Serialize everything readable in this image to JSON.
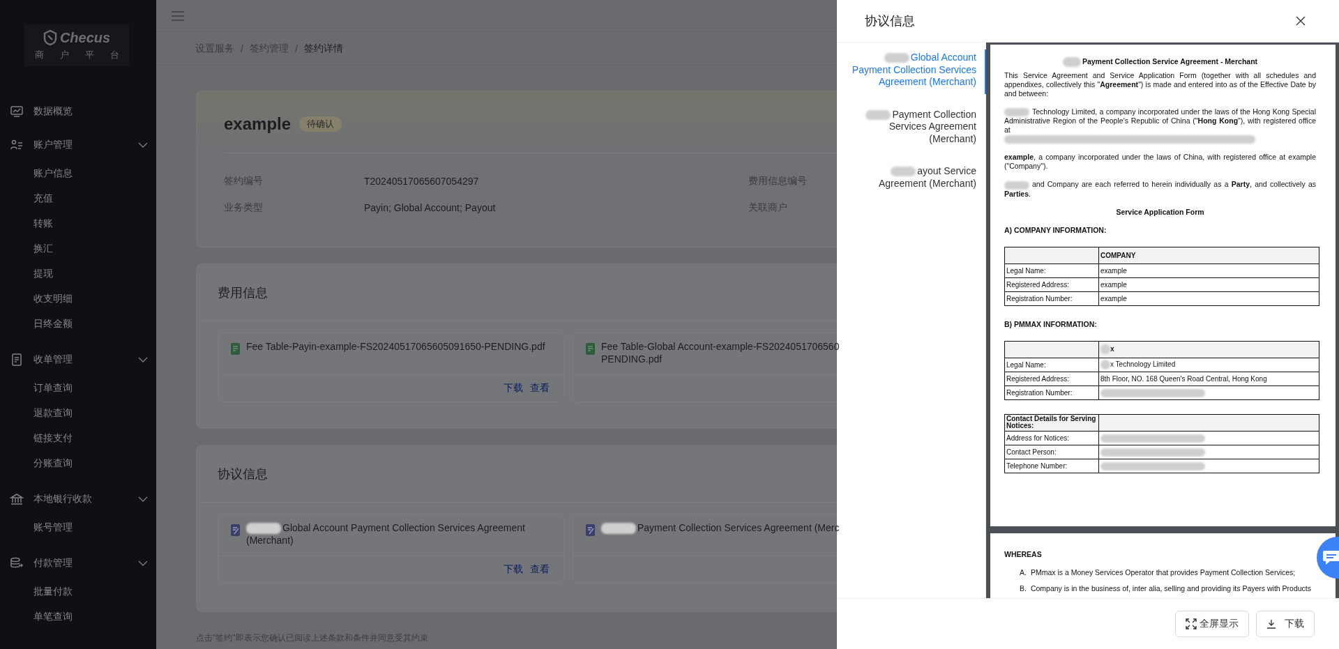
{
  "sidebar": {
    "logo_text": "Checus",
    "logo_subtitle": "商户平台",
    "items": [
      {
        "kind": "link",
        "label": "数据概览"
      },
      {
        "kind": "group",
        "label": "账户管理",
        "expanded": true,
        "children": [
          {
            "label": "账户信息"
          },
          {
            "label": "充值"
          },
          {
            "label": "转账"
          },
          {
            "label": "换汇"
          },
          {
            "label": "提现"
          },
          {
            "label": "收支明细"
          },
          {
            "label": "日终金额"
          }
        ]
      },
      {
        "kind": "group",
        "label": "收单管理",
        "expanded": true,
        "children": [
          {
            "label": "订单查询"
          },
          {
            "label": "退款查询"
          },
          {
            "label": "链接支付"
          },
          {
            "label": "分账查询"
          }
        ]
      },
      {
        "kind": "group",
        "label": "本地银行收款",
        "expanded": true,
        "children": [
          {
            "label": "账号管理"
          }
        ]
      },
      {
        "kind": "group",
        "label": "付款管理",
        "expanded": true,
        "children": [
          {
            "label": "批量付款"
          },
          {
            "label": "单笔查询"
          }
        ]
      }
    ]
  },
  "breadcrumb": {
    "separator": "/",
    "items": [
      {
        "label": "设置服务",
        "current": false
      },
      {
        "label": "签约管理",
        "current": false
      },
      {
        "label": "签约详情",
        "current": true
      }
    ]
  },
  "contract": {
    "name": "example",
    "status": "待确认",
    "fields": [
      {
        "label": "签约编号",
        "value": "T20240517065607054297",
        "side_label": "费用信息编号"
      },
      {
        "label": "业务类型",
        "value": "Payin; Global Account; Payout",
        "side_label": "关联商户"
      }
    ]
  },
  "sections": [
    {
      "title": "费用信息",
      "files": [
        {
          "kind": "fee",
          "redacted": false,
          "lines": [
            "Fee Table-Payin-example-FS20240517065605091650-PENDING.pdf"
          ],
          "actions": [
            "下载",
            "查看"
          ]
        },
        {
          "kind": "fee",
          "redacted": false,
          "lines": [
            "Fee Table-Global Account-example-FS2024051706560",
            "PENDING.pdf"
          ]
        }
      ]
    },
    {
      "title": "协议信息",
      "files": [
        {
          "kind": "agreement",
          "redacted": true,
          "lines": [
            "Global Account Payment Collection Services Agreement",
            "(Merchant)"
          ],
          "actions": [
            "下载",
            "查看"
          ]
        },
        {
          "kind": "agreement",
          "redacted": true,
          "lines": [
            "Payment Collection Services Agreement (Merc"
          ]
        }
      ]
    }
  ],
  "note": "点击\"签约\"即表示您确认已阅读上述条款和条件并同意受其约束",
  "drawer": {
    "title": "协议信息",
    "tabs": [
      {
        "text": "Global Account Payment Collection Services Agreement (Merchant)",
        "selected": true
      },
      {
        "text": "Payment Collection Services Agreement (Merchant)",
        "selected": false
      },
      {
        "text": "ayout Service Agreement (Merchant)",
        "selected": false
      }
    ],
    "document": {
      "title": "Payment Collection Service Agreement - Merchant",
      "paragraphs": [
        {
          "blur_start": false,
          "blur_end": false,
          "text": "This Service Agreement and Service Application Form (together with all schedules and appendixes, collectively this \"**Agreement**\") is made and entered into as of the Effective Date by and between:"
        },
        {
          "blur_start": true,
          "blur_end": true,
          "text": "Technology Limited, a company incorporated under the laws of the Hong Kong Special Administrative Region of the People's Republic of China (\"**Hong Kong**\"), with registered office at"
        },
        {
          "blur_start": false,
          "blur_end": false,
          "text": "**example**, a company incorporated under the laws of China, with registered office at example (\"Company\")."
        },
        {
          "blur_start": true,
          "blur_end": false,
          "text": "and Company are each referred to herein individually as a **Party**, and collectively as **Parties**."
        }
      ],
      "form_title": "Service Application Form",
      "tables": [
        {
          "heading": "A)  COMPANY INFORMATION:",
          "header": {
            "value": {
              "text": "COMPANY",
              "blur": false
            }
          },
          "rows": [
            {
              "label": "Legal Name:",
              "value": {
                "text": "example",
                "blur": false
              }
            },
            {
              "label": "Registered Address:",
              "value": {
                "text": "example",
                "blur": false
              }
            },
            {
              "label": "Registration Number:",
              "value": {
                "text": "example",
                "blur": false
              }
            }
          ]
        },
        {
          "heading": "B)  PMMAX INFORMATION:",
          "header": {
            "value": {
              "text": "x",
              "blur": true
            }
          },
          "rows": [
            {
              "label": "Legal Name:",
              "value": {
                "text": "x Technology Limited",
                "blur": true
              }
            },
            {
              "label": "Registered Address:",
              "value": {
                "text": "8th Floor, NO. 168 Queen's Road Central, Hong Kong",
                "blur": false
              }
            },
            {
              "label": "Registration Number:",
              "value": {
                "blur": true
              }
            }
          ]
        },
        {
          "header": {
            "label": "Contact Details for Serving Notices:"
          },
          "rows": [
            {
              "label": "Address for Notices:",
              "value": {
                "blur": true
              }
            },
            {
              "label": "Contact Person:",
              "value": {
                "blur": true
              }
            },
            {
              "label": "Telephone Number:",
              "value": {
                "blur": true
              }
            }
          ]
        }
      ],
      "page2": {
        "heading": "WHEREAS",
        "items": [
          {
            "marker": "A.",
            "text": "PMmax is a Money Services Operator that provides Payment Collection Services;"
          },
          {
            "marker": "B.",
            "text": "Company is in the business of, inter alia, selling and providing its Payers with Products"
          }
        ]
      }
    },
    "buttons": [
      {
        "kind": "fullscreen",
        "label": "全屏显示"
      },
      {
        "kind": "download",
        "label": "下载"
      }
    ]
  }
}
